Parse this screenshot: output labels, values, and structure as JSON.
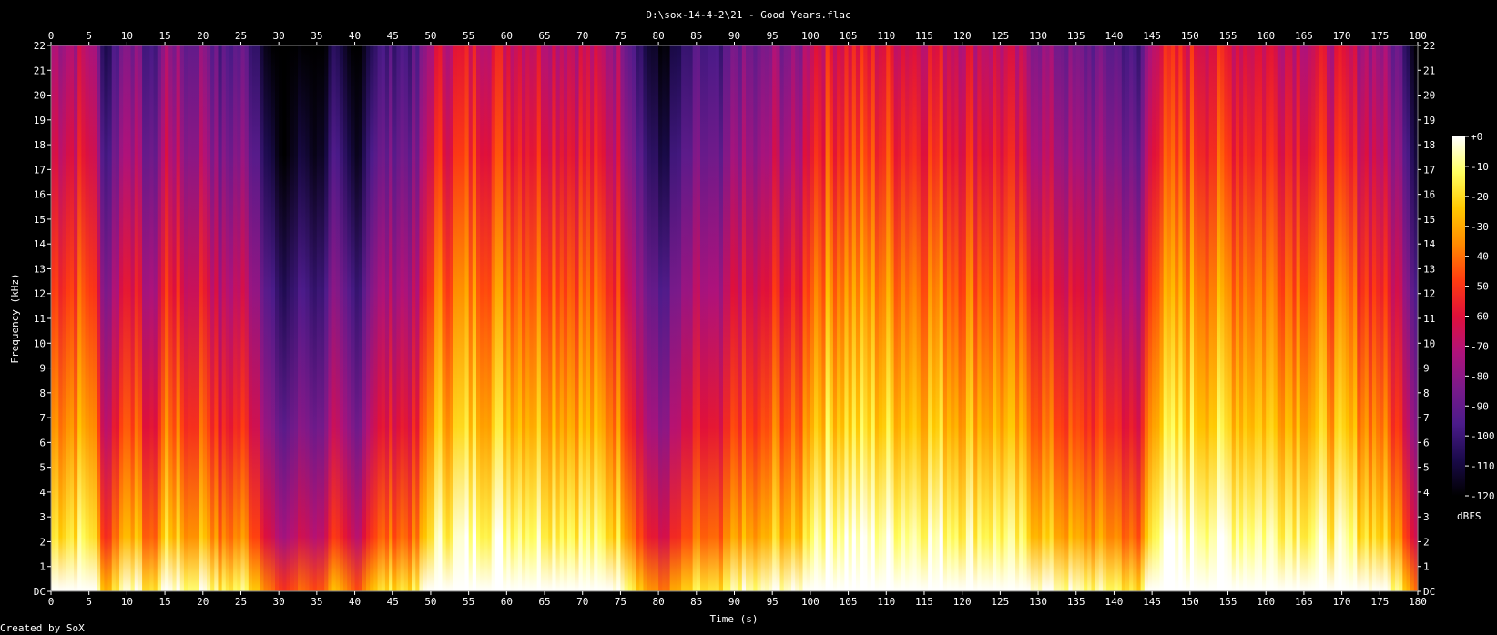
{
  "chart_data": {
    "type": "heatmap",
    "title": "D:\\sox-14-4-2\\21 - Good Years.flac",
    "xlabel": "Time (s)",
    "ylabel": "Frequency (kHz)",
    "xlim": [
      0,
      180
    ],
    "ylim": [
      0,
      22
    ],
    "x_ticks": [
      0,
      5,
      10,
      15,
      20,
      25,
      30,
      35,
      40,
      45,
      50,
      55,
      60,
      65,
      70,
      75,
      80,
      85,
      90,
      95,
      100,
      105,
      110,
      115,
      120,
      125,
      130,
      135,
      140,
      145,
      150,
      155,
      160,
      165,
      170,
      175,
      180
    ],
    "y_ticks": [
      "DC",
      "1",
      "2",
      "3",
      "4",
      "5",
      "6",
      "7",
      "8",
      "9",
      "10",
      "11",
      "12",
      "13",
      "14",
      "15",
      "16",
      "17",
      "18",
      "19",
      "20",
      "21",
      "22"
    ],
    "colorbar": {
      "label": "dBFS",
      "ticks": [
        "+0",
        "-10",
        "-20",
        "-30",
        "-40",
        "-50",
        "-60",
        "-70",
        "-80",
        "-90",
        "-100",
        "-110",
        "-120"
      ],
      "range": [
        -120,
        0
      ],
      "colors": [
        "#000000",
        "#1a0a4a",
        "#4b1b8a",
        "#7a1a8a",
        "#b0127a",
        "#e0103a",
        "#ff3c10",
        "#ff8a00",
        "#ffc800",
        "#ffff60",
        "#ffffff"
      ]
    },
    "energy_profile": {
      "description_units": "relative loudness over time (0-1), used to shade spectrogram",
      "times": [
        0,
        5,
        7,
        10,
        13,
        15,
        18,
        20,
        22,
        25,
        27,
        30,
        33,
        35,
        37,
        40,
        42,
        45,
        48,
        50,
        55,
        60,
        65,
        70,
        75,
        78,
        80,
        85,
        88,
        90,
        93,
        95,
        98,
        100,
        105,
        110,
        115,
        120,
        125,
        130,
        135,
        140,
        143,
        145,
        150,
        155,
        160,
        165,
        170,
        175,
        178,
        180
      ],
      "levels": [
        0.75,
        0.78,
        0.45,
        0.72,
        0.5,
        0.74,
        0.6,
        0.7,
        0.55,
        0.6,
        0.5,
        0.25,
        0.35,
        0.3,
        0.45,
        0.3,
        0.5,
        0.55,
        0.55,
        0.8,
        0.85,
        0.85,
        0.82,
        0.8,
        0.72,
        0.45,
        0.35,
        0.55,
        0.5,
        0.65,
        0.6,
        0.7,
        0.65,
        0.85,
        0.88,
        0.86,
        0.85,
        0.82,
        0.8,
        0.7,
        0.62,
        0.6,
        0.5,
        0.85,
        0.88,
        0.86,
        0.84,
        0.82,
        0.8,
        0.72,
        0.55,
        0.3
      ]
    }
  },
  "credit": "Created by SoX"
}
